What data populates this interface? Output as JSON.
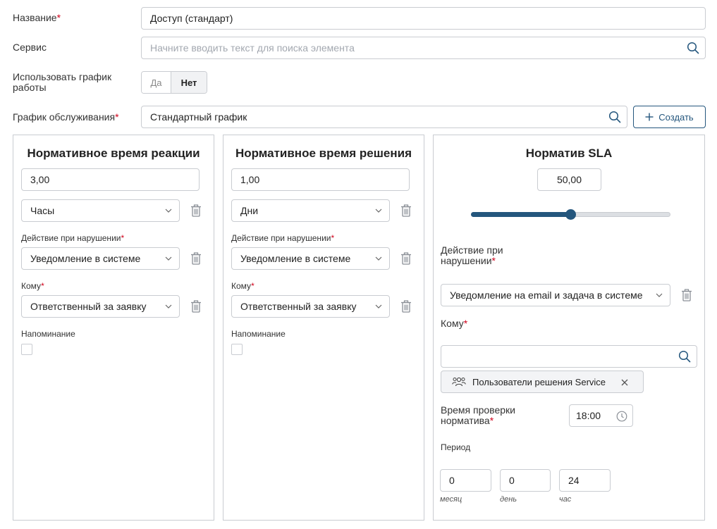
{
  "form": {
    "name_label": "Название",
    "name_value": "Доступ (стандарт)",
    "service_label": "Сервис",
    "service_placeholder": "Начните вводить текст для поиска элемента",
    "schedule_use_label": "Использовать график работы",
    "schedule_use_yes": "Да",
    "schedule_use_no": "Нет",
    "schedule_use_selected": "Нет",
    "service_schedule_label": "График обслуживания",
    "service_schedule_value": "Стандартный график",
    "create_button": "Создать",
    "required_mark": "*"
  },
  "reaction_panel": {
    "title": "Нормативное время реакции",
    "time_value": "3,00",
    "unit_value": "Часы",
    "action_label": "Действие при нарушении",
    "action_value": "Уведомление в системе",
    "to_label": "Кому",
    "to_value": "Ответственный за заявку",
    "reminder_label": "Напоминание",
    "reminder_checked": false
  },
  "resolution_panel": {
    "title": "Нормативное время решения",
    "time_value": "1,00",
    "unit_value": "Дни",
    "action_label": "Действие при нарушении",
    "action_value": "Уведомление в системе",
    "to_label": "Кому",
    "to_value": "Ответственный за заявку",
    "reminder_label": "Напоминание",
    "reminder_checked": false
  },
  "sla_panel": {
    "title": "Норматив SLA",
    "value": "50,00",
    "slider_percent": 50,
    "action_label": "Действие при нарушении",
    "action_value": "Уведомление на email и задача в системе",
    "to_label": "Кому",
    "to_search_value": "",
    "to_tag": "Пользователи решения Service",
    "check_time_label": "Время проверки норматива",
    "check_time_value": "18:00",
    "period_label": "Период",
    "period": [
      {
        "value": "0",
        "unit": "месяц"
      },
      {
        "value": "0",
        "unit": "день"
      },
      {
        "value": "24",
        "unit": "час"
      }
    ]
  },
  "colors": {
    "accent": "#24567d",
    "required": "#d0021b",
    "border": "#c9ccd1",
    "slider_track": "#dcdfe3"
  }
}
